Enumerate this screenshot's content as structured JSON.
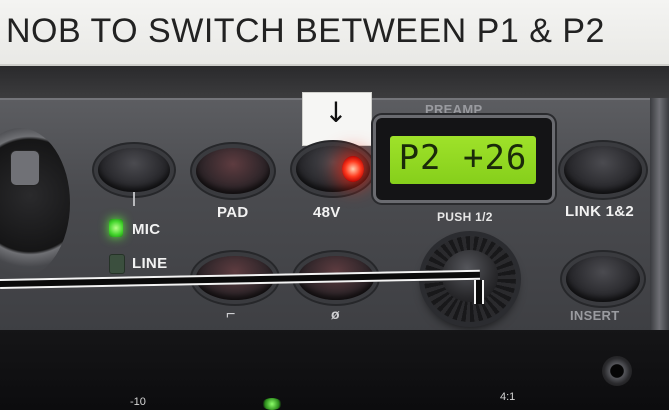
{
  "sign": {
    "text": "NOB TO SWITCH BETWEEN P1 & P2"
  },
  "sticker": {
    "arrow": "↓"
  },
  "panel": {
    "preamp_label": "PREAMP",
    "display_value": "P2 +26",
    "push_label": "PUSH 1/2",
    "pad_label": "PAD",
    "phantom_label": "48V",
    "link_label": "LINK 1&2",
    "insert_label": "INSERT",
    "mic_label": "MIC",
    "line_label": "LINE",
    "filter_glyph": "⌐",
    "phase_glyph": "ø",
    "mic_led_on": true,
    "line_led_on": false,
    "phantom_led_on": true
  },
  "meter": {
    "left_tick": "-10",
    "ratio_label": "4:1"
  },
  "colors": {
    "lcd_bg": "#9fe22a",
    "led_green": "#43d52c",
    "led_red": "#ff3b1f",
    "faceplate": "#4a4b4f"
  }
}
